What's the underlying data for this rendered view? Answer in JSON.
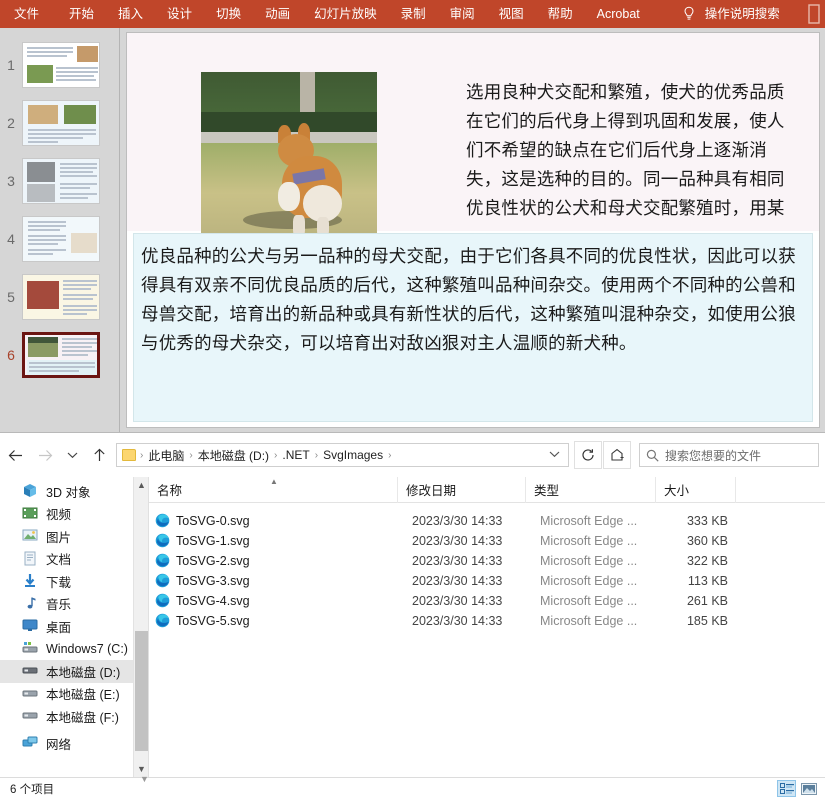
{
  "powerpoint": {
    "ribbon": {
      "tabs": [
        {
          "label": "文件",
          "name": "tab-file"
        },
        {
          "label": "开始",
          "name": "tab-home"
        },
        {
          "label": "插入",
          "name": "tab-insert"
        },
        {
          "label": "设计",
          "name": "tab-design"
        },
        {
          "label": "切换",
          "name": "tab-transitions"
        },
        {
          "label": "动画",
          "name": "tab-animations"
        },
        {
          "label": "幻灯片放映",
          "name": "tab-slideshow"
        },
        {
          "label": "录制",
          "name": "tab-record"
        },
        {
          "label": "审阅",
          "name": "tab-review"
        },
        {
          "label": "视图",
          "name": "tab-view"
        },
        {
          "label": "帮助",
          "name": "tab-help"
        },
        {
          "label": "Acrobat",
          "name": "tab-acrobat"
        }
      ],
      "tellme_label": "操作说明搜索",
      "tellme_icon": "lightbulb-icon",
      "accent_color": "#c0462a",
      "text_color": "#ffffff"
    },
    "thumbnails": {
      "selected_index": 6,
      "selection_color": "#6b1512",
      "items": [
        {
          "number": "1"
        },
        {
          "number": "2"
        },
        {
          "number": "3"
        },
        {
          "number": "4"
        },
        {
          "number": "5"
        },
        {
          "number": "6"
        }
      ]
    },
    "slide": {
      "background_color": "#faf4f7",
      "image_alt": "corgi-running-on-grass-photo",
      "top_text": "选用良种犬交配和繁殖，使犬的优秀品质在它们的后代身上得到巩固和发展，使人们不希望的缺点在它们后代身上逐渐消失，这是选种的目的。同一品种具有相同优良性状的公犬和母犬交配繁殖时，用某一",
      "bottom_box_color": "#e8f6fa",
      "bottom_text": "优良品种的公犬与另一品种的母犬交配，由于它们各具不同的优良性状，因此可以获得具有双亲不同优良品质的后代，这种繁殖叫品种间杂交。使用两个不同种的公兽和母兽交配，培育出的新品种或具有新性状的后代，这种繁殖叫混种杂交，如使用公狼与优秀的母犬杂交，可以培育出对敌凶狠对主人温顺的新犬种。"
    }
  },
  "explorer": {
    "nav": {
      "back_icon": "arrow-left-icon",
      "forward_icon": "arrow-right-icon",
      "recent_icon": "chevron-down-icon",
      "up_icon": "arrow-up-icon",
      "refresh_icon": "refresh-icon",
      "favorite_icon": "add-favorite-icon",
      "dropdown_icon": "chevron-down-icon"
    },
    "breadcrumb": {
      "folder_icon": "folder-icon",
      "crumbs": [
        "此电脑",
        "本地磁盘 (D:)",
        ".NET",
        "SvgImages"
      ],
      "separator": "›"
    },
    "search": {
      "icon": "search-icon",
      "placeholder": "搜索您想要的文件",
      "value": ""
    },
    "tree": {
      "selected": "本地磁盘 (D:)",
      "items": [
        {
          "label": "3D 对象",
          "icon": "3d-objects-icon"
        },
        {
          "label": "视频",
          "icon": "videos-icon"
        },
        {
          "label": "图片",
          "icon": "pictures-icon"
        },
        {
          "label": "文档",
          "icon": "documents-icon"
        },
        {
          "label": "下载",
          "icon": "downloads-icon"
        },
        {
          "label": "音乐",
          "icon": "music-icon"
        },
        {
          "label": "桌面",
          "icon": "desktop-icon"
        },
        {
          "label": "Windows7 (C:)",
          "icon": "system-drive-icon"
        },
        {
          "label": "本地磁盘 (D:)",
          "icon": "drive-icon"
        },
        {
          "label": "本地磁盘 (E:)",
          "icon": "drive-icon"
        },
        {
          "label": "本地磁盘 (F:)",
          "icon": "drive-icon"
        },
        {
          "label": "网络",
          "icon": "network-icon"
        }
      ]
    },
    "file_list": {
      "columns": [
        {
          "label": "名称",
          "name": "col-name"
        },
        {
          "label": "修改日期",
          "name": "col-date"
        },
        {
          "label": "类型",
          "name": "col-type"
        },
        {
          "label": "大小",
          "name": "col-size"
        }
      ],
      "sort_indicator": "ascending-caret-icon",
      "rows": [
        {
          "name": "ToSVG-0.svg",
          "date": "2023/3/30 14:33",
          "type": "Microsoft Edge ...",
          "size": "333 KB",
          "icon": "edge-icon"
        },
        {
          "name": "ToSVG-1.svg",
          "date": "2023/3/30 14:33",
          "type": "Microsoft Edge ...",
          "size": "360 KB",
          "icon": "edge-icon"
        },
        {
          "name": "ToSVG-2.svg",
          "date": "2023/3/30 14:33",
          "type": "Microsoft Edge ...",
          "size": "322 KB",
          "icon": "edge-icon"
        },
        {
          "name": "ToSVG-3.svg",
          "date": "2023/3/30 14:33",
          "type": "Microsoft Edge ...",
          "size": "113 KB",
          "icon": "edge-icon"
        },
        {
          "name": "ToSVG-4.svg",
          "date": "2023/3/30 14:33",
          "type": "Microsoft Edge ...",
          "size": "261 KB",
          "icon": "edge-icon"
        },
        {
          "name": "ToSVG-5.svg",
          "date": "2023/3/30 14:33",
          "type": "Microsoft Edge ...",
          "size": "185 KB",
          "icon": "edge-icon"
        }
      ]
    },
    "status": {
      "count_label": "6 个项目",
      "view_details_icon": "details-view-icon",
      "view_tiles_icon": "large-icons-view-icon",
      "active_view": "details"
    }
  }
}
